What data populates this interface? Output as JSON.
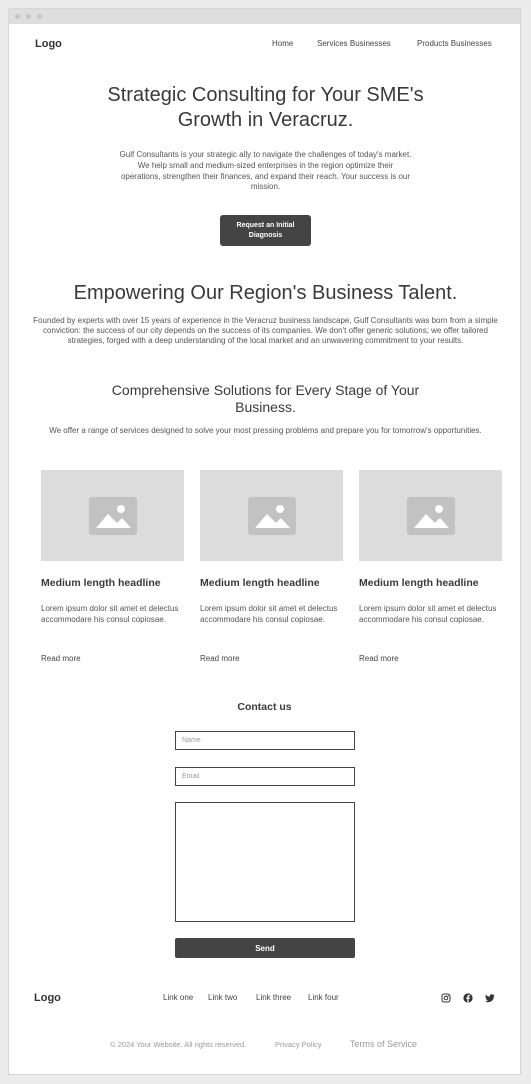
{
  "header": {
    "logo": "Logo",
    "nav": [
      "Home",
      "Services Businesses",
      "Products Businesses"
    ]
  },
  "hero": {
    "title": "Strategic Consulting for Your SME's Growth in Veracruz.",
    "text": "Gulf Consultants is your strategic ally to navigate the challenges of today's market. We help small and medium-sized enterprises in the region optimize their operations, strengthen their finances, and expand their reach. Your success is our mission.",
    "cta": "Request an Initial Diagnosis"
  },
  "about": {
    "title": "Empowering Our Region's Business Talent.",
    "text": "Founded by experts with over 15 years of experience in the Veracruz business landscape, Gulf Consultants was born from a simple conviction: the success of our city depends on the success of its companies. We don't offer generic solutions; we offer tailored strategies, forged with a deep understanding of the local market and an unwavering commitment to your results."
  },
  "services": {
    "title": "Comprehensive Solutions for Every Stage of Your Business.",
    "subtitle": "We offer a range of services designed to solve your most pressing problems and prepare you for tomorrow's opportunities.",
    "cards": [
      {
        "headline": "Medium length headline",
        "body": "Lorem ipsum dolor sit amet et delectus accommodare his consul copiosae.",
        "link": "Read more",
        "image_icon": "image-placeholder-icon"
      },
      {
        "headline": "Medium length headline",
        "body": "Lorem ipsum dolor sit amet et delectus accommodare his consul copiosae.",
        "link": "Read more",
        "image_icon": "image-placeholder-icon"
      },
      {
        "headline": "Medium length headline",
        "body": "Lorem ipsum dolor sit amet et delectus accommodare his consul copiosae.",
        "link": "Read more",
        "image_icon": "image-placeholder-icon"
      }
    ]
  },
  "contact": {
    "title": "Contact us",
    "name_placeholder": "Name",
    "email_placeholder": "Email",
    "message_placeholder": "",
    "send": "Send"
  },
  "footer": {
    "logo": "Logo",
    "links": [
      "Link one",
      "Link two",
      "Link three",
      "Link four"
    ],
    "social_icons": [
      "instagram-icon",
      "facebook-icon",
      "twitter-icon"
    ],
    "copyright": "© 2024 Your Website. All rights reserved.",
    "privacy": "Privacy Policy",
    "terms": "Terms of Service"
  },
  "colors": {
    "page_bg": "#ececec",
    "window_bg": "#ffffff",
    "dark_button": "#444444",
    "image_placeholder": "#dcdcdc"
  }
}
